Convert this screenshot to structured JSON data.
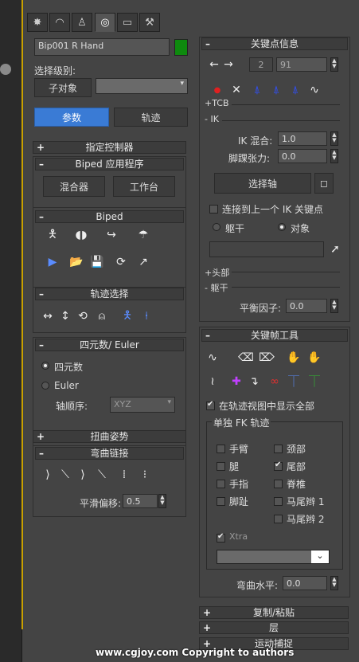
{
  "tabs": [
    "sun-icon",
    "curve-icon",
    "hierarchy-icon",
    "motion-icon",
    "display-icon",
    "hammer-icon"
  ],
  "object_name": "Bip001 R Hand",
  "object_color": "#0e8a0e",
  "selection_level_label": "选择级别:",
  "sub_object_label": "子对象",
  "mode_params": "参数",
  "mode_track": "轨迹",
  "rollouts_left": {
    "assign_controller": "指定控制器",
    "biped_apps": {
      "title": "Biped 应用程序",
      "mixer": "混合器",
      "workbench": "工作台"
    },
    "biped": {
      "title": "Biped"
    },
    "track_selection": {
      "title": "轨迹选择"
    },
    "quaternion": {
      "title": "四元数/ Euler",
      "quaternion": "四元数",
      "euler": "Euler",
      "axis_order_label": "轴顺序:",
      "axis_order_value": "XYZ"
    },
    "twist_poses": "扭曲姿势",
    "bend_links": {
      "title": "弯曲链接",
      "smooth_bias_label": "平滑偏移:",
      "smooth_bias_value": "0.5"
    }
  },
  "rollouts_right": {
    "key_info": {
      "title": "关键点信息",
      "key_index": "2",
      "frame": "91",
      "tcb": "+TCB",
      "ik": "- IK",
      "ik_blend_label": "IK 混合:",
      "ik_blend_value": "1.0",
      "ankle_tension_label": "脚踝张力:",
      "ankle_tension_value": "0.0",
      "select_pivot": "选择轴",
      "join_prev": "连接到上一个 IK 关键点",
      "body": "躯干",
      "object": "对象",
      "head": "+头部",
      "torso": "- 躯干",
      "balance_label": "平衡因子:",
      "balance_value": "0.0"
    },
    "keyframing_tools": {
      "title": "关键帧工具",
      "show_all": "在轨迹视图中显示全部",
      "separate_fk": "单独 FK 轨迹",
      "tracks": [
        {
          "label": "手臂",
          "on": false
        },
        {
          "label": "颈部",
          "on": false
        },
        {
          "label": "腿",
          "on": false
        },
        {
          "label": "尾部",
          "on": true
        },
        {
          "label": "手指",
          "on": false
        },
        {
          "label": "脊椎",
          "on": false
        },
        {
          "label": "脚趾",
          "on": false
        },
        {
          "label": "马尾辫 1",
          "on": false
        },
        {
          "label": "马尾辫 2",
          "on": false
        }
      ],
      "xtra": "Xtra",
      "bend_horizontal_label": "弯曲水平:",
      "bend_horizontal_value": "0.0"
    },
    "copy_paste": "复制/粘贴",
    "layers": "层",
    "motion_capture": "运动捕捉"
  },
  "watermark": "www.cgjoy.com Copyright to authors"
}
